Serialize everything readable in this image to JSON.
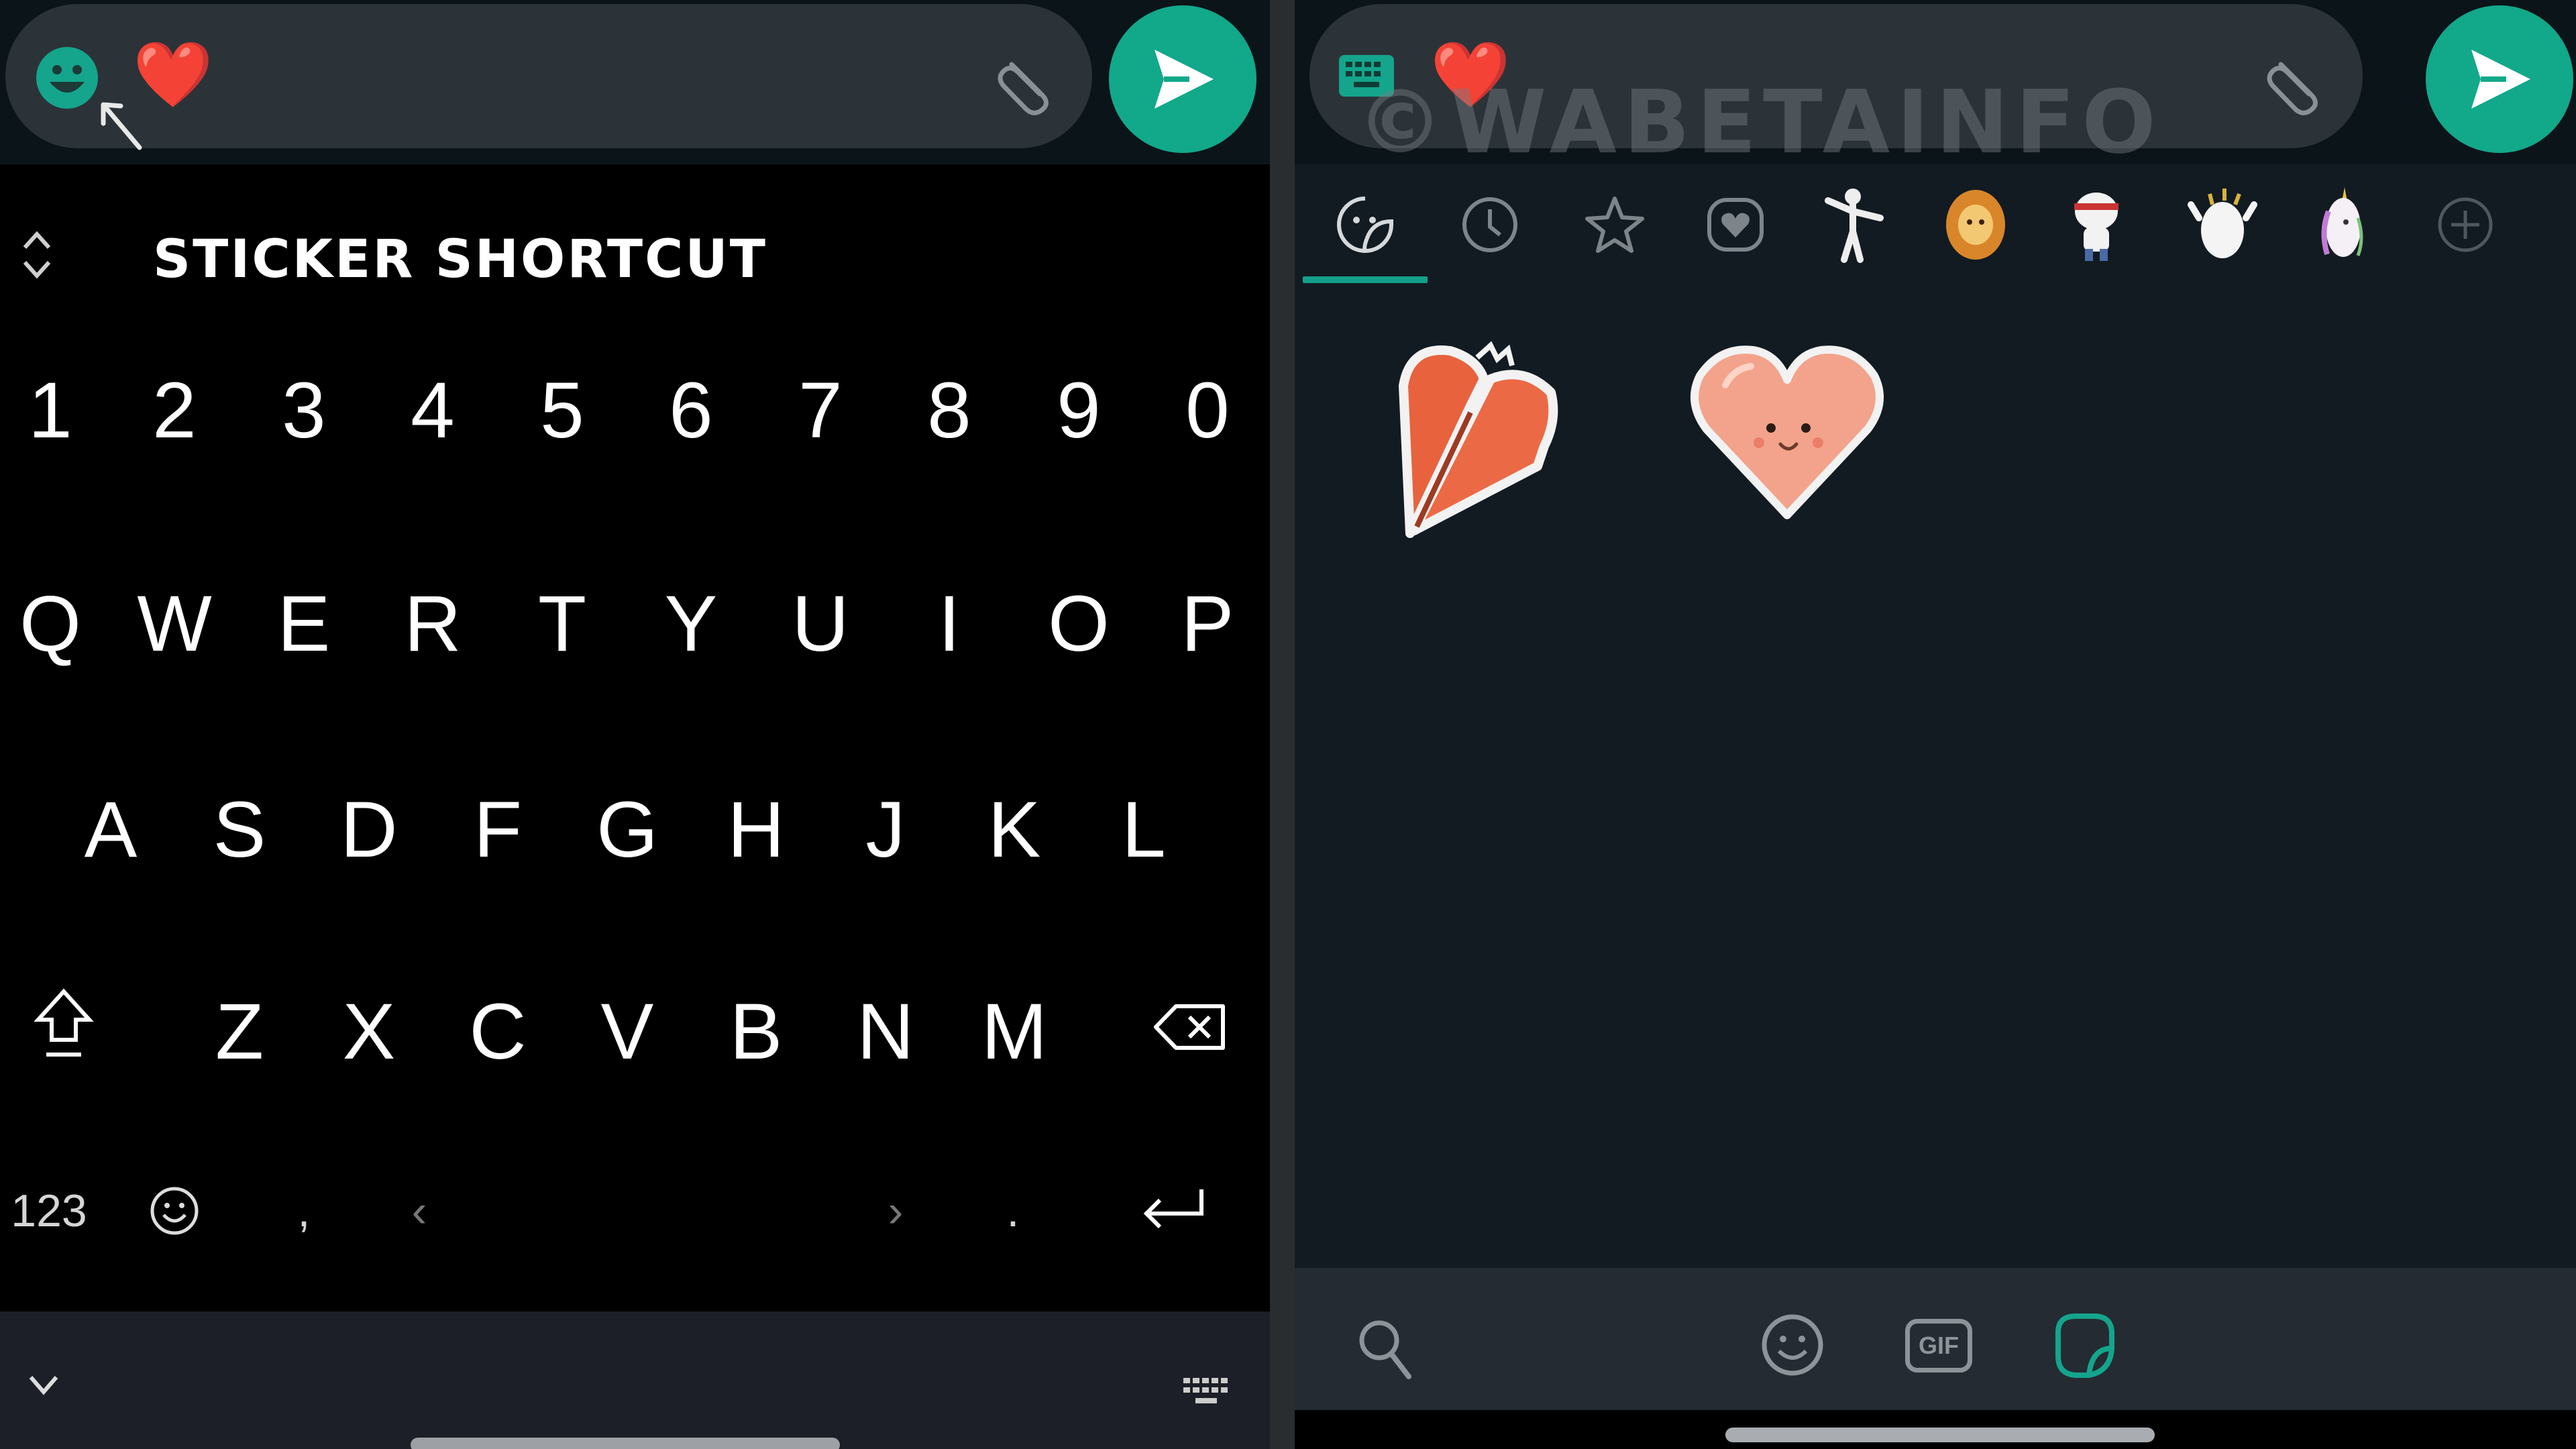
{
  "left_screen": {
    "compose": {
      "emoji_icon": "emoji-icon",
      "message_text": "❤️",
      "attach_icon": "paperclip-icon",
      "send_icon": "send-icon",
      "pointer_icon": "arrow-pointer-icon"
    },
    "keyboard": {
      "header_title": "STICKER SHORTCUT",
      "rows": [
        [
          "1",
          "2",
          "3",
          "4",
          "5",
          "6",
          "7",
          "8",
          "9",
          "0"
        ],
        [
          "Q",
          "W",
          "E",
          "R",
          "T",
          "Y",
          "U",
          "I",
          "O",
          "P"
        ],
        [
          "A",
          "S",
          "D",
          "F",
          "G",
          "H",
          "J",
          "K",
          "L"
        ],
        [
          "Z",
          "X",
          "C",
          "V",
          "B",
          "N",
          "M"
        ]
      ],
      "bottom_row": {
        "numbers_label": "123",
        "comma": ",",
        "left_arrow": "‹",
        "right_arrow": "›",
        "period": "."
      },
      "icons": {
        "shift": "shift-icon",
        "backspace": "backspace-icon",
        "emoji": "emoji-icon",
        "enter": "enter-icon",
        "collapse": "chevron-down-icon",
        "keyboard_switch": "keyboard-icon"
      }
    }
  },
  "right_screen": {
    "compose": {
      "keyboard_icon": "keyboard-icon",
      "message_text": "❤️",
      "watermark": "©WABETAINFO",
      "attach_icon": "paperclip-icon",
      "send_icon": "send-icon"
    },
    "sticker_tabs": [
      {
        "name": "emoji-sticker-tab",
        "icon": "sticker-face-icon",
        "active": true
      },
      {
        "name": "recent-tab",
        "icon": "clock-icon",
        "active": false
      },
      {
        "name": "favorites-tab",
        "icon": "star-icon",
        "active": false
      },
      {
        "name": "love-tab",
        "icon": "heart-badge-icon",
        "active": false
      },
      {
        "name": "pack-1",
        "icon": "dancing-figure-sticker",
        "active": false
      },
      {
        "name": "pack-2",
        "icon": "lion-sticker",
        "active": false
      },
      {
        "name": "pack-3",
        "icon": "character-sticker",
        "active": false
      },
      {
        "name": "pack-4",
        "icon": "cheering-character-sticker",
        "active": false
      },
      {
        "name": "pack-5",
        "icon": "unicorn-sticker",
        "active": false
      },
      {
        "name": "add-pack",
        "icon": "plus-icon",
        "active": false
      }
    ],
    "stickers": [
      {
        "name": "broken-heart-sticker"
      },
      {
        "name": "smiling-heart-sticker"
      }
    ],
    "bottom_bar": {
      "search_icon": "search-icon",
      "emoji_tab": "emoji-icon",
      "gif_label": "GIF",
      "sticker_tab": "sticker-icon",
      "active": "sticker"
    }
  },
  "colors": {
    "accent": "#12a88a",
    "compose_bg": "#2b3338",
    "sticker_panel_bg": "#121b22",
    "keyboard_bg": "#000000"
  }
}
